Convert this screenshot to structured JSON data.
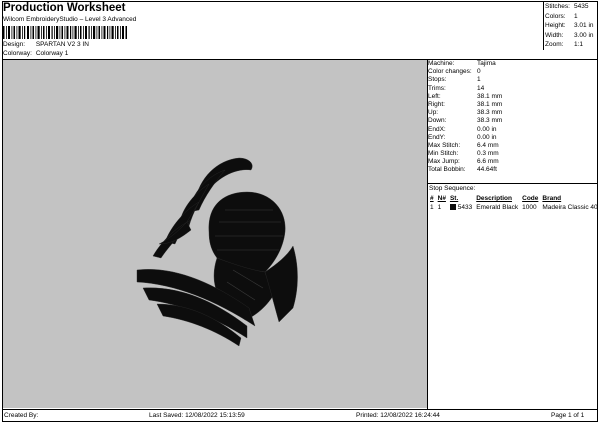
{
  "header": {
    "title": "Production Worksheet",
    "subtitle": "Wilcom EmbroideryStudio – Level 3 Advanced",
    "design_label": "Design:",
    "design_value": "SPARTAN V2 3 IN",
    "colorway_label": "Colorway:",
    "colorway_value": "Colorway 1"
  },
  "summary": [
    {
      "label": "Stitches:",
      "value": "5435"
    },
    {
      "label": "Colors:",
      "value": "1"
    },
    {
      "label": "Height:",
      "value": "3.01 in"
    },
    {
      "label": "Width:",
      "value": "3.00 in"
    },
    {
      "label": "Zoom:",
      "value": "1:1"
    }
  ],
  "machine_info": [
    {
      "label": "Machine:",
      "value": "Tajima"
    },
    {
      "label": "Color changes:",
      "value": "0"
    },
    {
      "label": "Stops:",
      "value": "1"
    },
    {
      "label": "Trims:",
      "value": "14"
    },
    {
      "label": "Left:",
      "value": "38.1 mm"
    },
    {
      "label": "Right:",
      "value": "38.1 mm"
    },
    {
      "label": "Up:",
      "value": "38.3 mm"
    },
    {
      "label": "Down:",
      "value": "38.3 mm"
    },
    {
      "label": "EndX:",
      "value": "0.00 in"
    },
    {
      "label": "EndY:",
      "value": "0.00 in"
    },
    {
      "label": "Max Stitch:",
      "value": "6.4 mm"
    },
    {
      "label": "Min Stitch:",
      "value": "0.3 mm"
    },
    {
      "label": "Max Jump:",
      "value": "6.6 mm"
    },
    {
      "label": "Total Bobbin:",
      "value": "44.64ft"
    }
  ],
  "stop_sequence": {
    "title": "Stop Sequence:",
    "headers": [
      "#",
      "N#",
      "St.",
      "Description",
      "Code",
      "Brand"
    ],
    "rows": [
      [
        "1",
        "1",
        "5433",
        "Emerald Black",
        "1000",
        "Madeira Classic 40"
      ]
    ]
  },
  "colors": {
    "canvas_bg": "#c3c3c3",
    "thread": "#0d0d0d"
  },
  "footer": {
    "created_by": "Created By:",
    "last_saved": "Last Saved: 12/08/2022 15:13:59",
    "printed": "Printed: 12/08/2022 16:24:44",
    "page": "Page 1 of 1"
  }
}
